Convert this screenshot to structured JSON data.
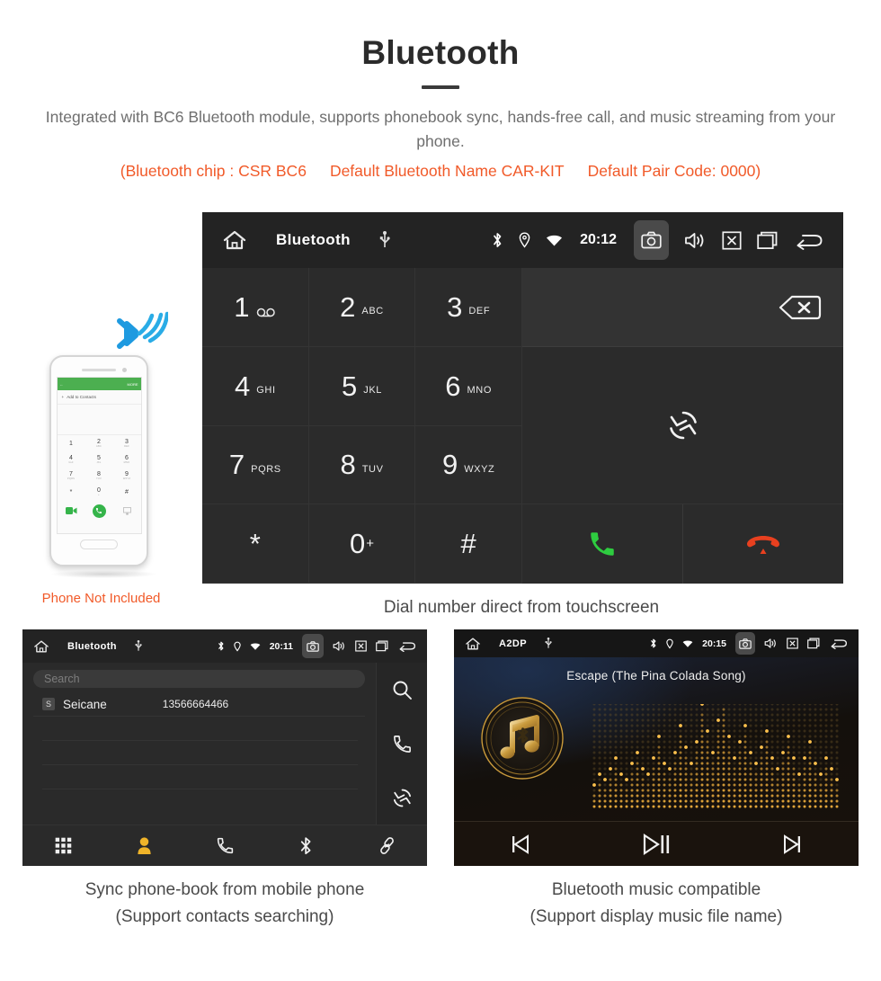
{
  "header": {
    "title": "Bluetooth",
    "subtitle": "Integrated with BC6 Bluetooth module, supports phonebook sync, hands-free call, and music streaming from your phone.",
    "specs": [
      "(Bluetooth chip : CSR BC6",
      "Default Bluetooth Name CAR-KIT",
      "Default Pair Code: 0000)"
    ],
    "accent_color": "#f15a29"
  },
  "phone_mock": {
    "note": "Phone Not Included",
    "appbar_more": "MORE",
    "add_contact": "Add to Contacts",
    "keys": [
      {
        "digit": "1",
        "letters": ""
      },
      {
        "digit": "2",
        "letters": "ABC"
      },
      {
        "digit": "3",
        "letters": "DEF"
      },
      {
        "digit": "4",
        "letters": "GHI"
      },
      {
        "digit": "5",
        "letters": "JKL"
      },
      {
        "digit": "6",
        "letters": "MNO"
      },
      {
        "digit": "7",
        "letters": "PQRS"
      },
      {
        "digit": "8",
        "letters": "TUV"
      },
      {
        "digit": "9",
        "letters": "WXYZ"
      },
      {
        "digit": "*",
        "letters": ""
      },
      {
        "digit": "0",
        "letters": "+"
      },
      {
        "digit": "#",
        "letters": ""
      }
    ]
  },
  "dialer": {
    "statusbar": {
      "title": "Bluetooth",
      "time": "20:12",
      "icons_left": [
        "home-icon",
        "usb-icon"
      ],
      "icons_right": [
        "bluetooth-icon",
        "location-icon",
        "wifi-icon",
        "camera-icon",
        "volume-icon",
        "close-box-icon",
        "recents-icon",
        "back-icon"
      ]
    },
    "keys": [
      {
        "digit": "1",
        "letters": "",
        "voicemail": true
      },
      {
        "digit": "2",
        "letters": "ABC"
      },
      {
        "digit": "3",
        "letters": "DEF"
      },
      {
        "digit": "4",
        "letters": "GHI"
      },
      {
        "digit": "5",
        "letters": "JKL"
      },
      {
        "digit": "6",
        "letters": "MNO"
      },
      {
        "digit": "7",
        "letters": "PQRS"
      },
      {
        "digit": "8",
        "letters": "TUV"
      },
      {
        "digit": "9",
        "letters": "WXYZ"
      },
      {
        "digit": "*",
        "letters": ""
      },
      {
        "digit": "0",
        "letters": "",
        "plus": "+"
      },
      {
        "digit": "#",
        "letters": ""
      }
    ],
    "number_input_value": "",
    "nav": [
      {
        "icon": "dialpad-icon",
        "active": true
      },
      {
        "icon": "contacts-icon",
        "active": false
      },
      {
        "icon": "call-log-icon",
        "active": false
      },
      {
        "icon": "bluetooth-icon",
        "active": false
      },
      {
        "icon": "link-icon",
        "active": false
      }
    ],
    "caption": "Dial number direct from touchscreen",
    "active_color": "#f0b429",
    "call_color": "#2ecc40",
    "hangup_color": "#e8401f"
  },
  "phonebook": {
    "statusbar": {
      "title": "Bluetooth",
      "time": "20:11"
    },
    "search_placeholder": "Search",
    "contacts": [
      {
        "initial": "S",
        "name": "Seicane",
        "number": "13566664466"
      }
    ],
    "side_actions": [
      "search-icon",
      "call-icon",
      "sync-icon"
    ],
    "nav": [
      {
        "icon": "dialpad-icon",
        "active": false
      },
      {
        "icon": "contacts-icon",
        "active": true
      },
      {
        "icon": "call-log-icon",
        "active": false
      },
      {
        "icon": "bluetooth-icon",
        "active": false
      },
      {
        "icon": "link-icon",
        "active": false
      }
    ],
    "caption_line1": "Sync phone-book from mobile phone",
    "caption_line2": "(Support contacts searching)"
  },
  "music": {
    "statusbar": {
      "title": "A2DP",
      "time": "20:15"
    },
    "track_title": "Escape (The Pina Colada Song)",
    "controls": [
      "previous-icon",
      "play-pause-icon",
      "next-icon"
    ],
    "accent_color": "#d9a441",
    "caption_line1": "Bluetooth music compatible",
    "caption_line2": "(Support display music file name)"
  }
}
